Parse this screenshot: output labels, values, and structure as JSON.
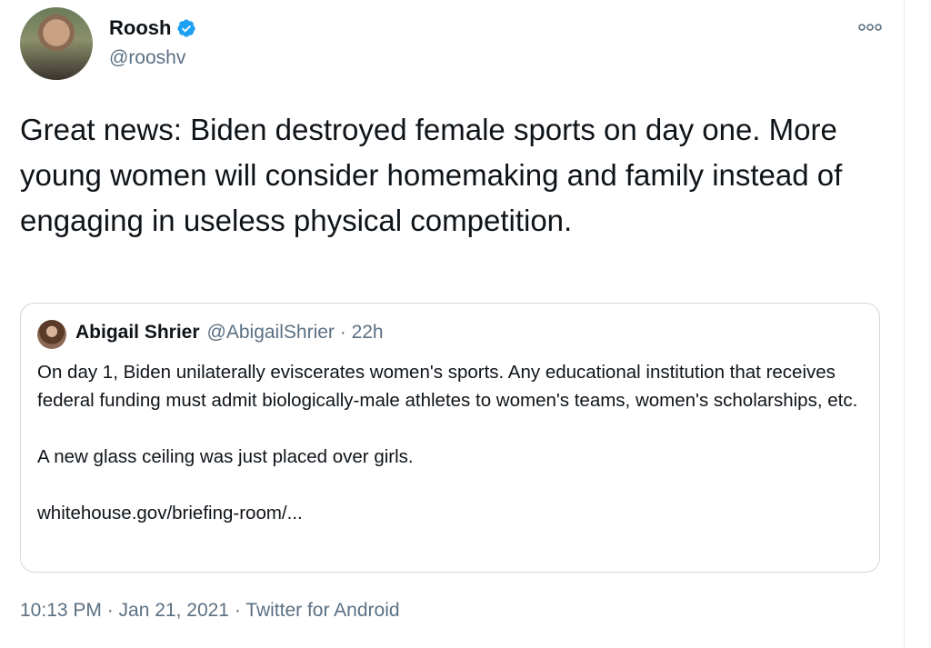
{
  "author": {
    "name": "Roosh",
    "handle": "@rooshv",
    "verified": true
  },
  "tweet": {
    "text": "Great news: Biden destroyed female sports on day one. More young women will consider homemaking and family instead of engaging in useless physical competition."
  },
  "quote": {
    "name": "Abigail Shrier",
    "meta": "@AbigailShrier · 22h",
    "paragraph1": "On day 1, Biden unilaterally eviscerates women's sports.  Any educational institution that receives federal funding must admit biologically-male athletes to women's teams, women's scholarships, etc.",
    "paragraph2": "A new glass ceiling was just placed over girls.",
    "link": "whitehouse.gov/briefing-room/..."
  },
  "meta": {
    "time_date": "10:13 PM · Jan 21, 2021",
    "separator": " · ",
    "source": "Twitter for Android"
  },
  "colors": {
    "verified_blue": "#1da1f2",
    "secondary_text": "#5b7083",
    "border": "#cfd9de"
  },
  "icons": {
    "verified": "verified-badge-icon",
    "more": "more-options-icon"
  }
}
